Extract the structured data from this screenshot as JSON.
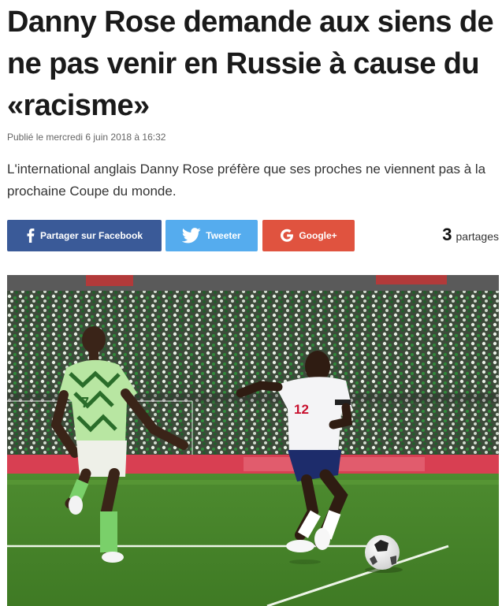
{
  "article": {
    "headline": "Danny Rose demande aux siens de ne pas venir en Russie à cause du «racisme»",
    "published": "Publié le mercredi 6 juin 2018 à 16:32",
    "lead": "L'international anglais Danny Rose préfère que ses proches ne viennent pas à la prochaine Coupe du monde."
  },
  "share": {
    "facebook_label": "Partager sur Facebook",
    "twitter_label": "Tweeter",
    "google_label": "Google+",
    "count": "3",
    "count_label": "partages",
    "colors": {
      "facebook": "#3a5a98",
      "twitter": "#55acee",
      "google": "#e0533f"
    },
    "icons": {
      "facebook": "facebook-icon",
      "twitter": "twitter-icon",
      "google": "google-icon"
    }
  },
  "photo": {
    "nigeria_number": "7",
    "england_number": "12"
  }
}
